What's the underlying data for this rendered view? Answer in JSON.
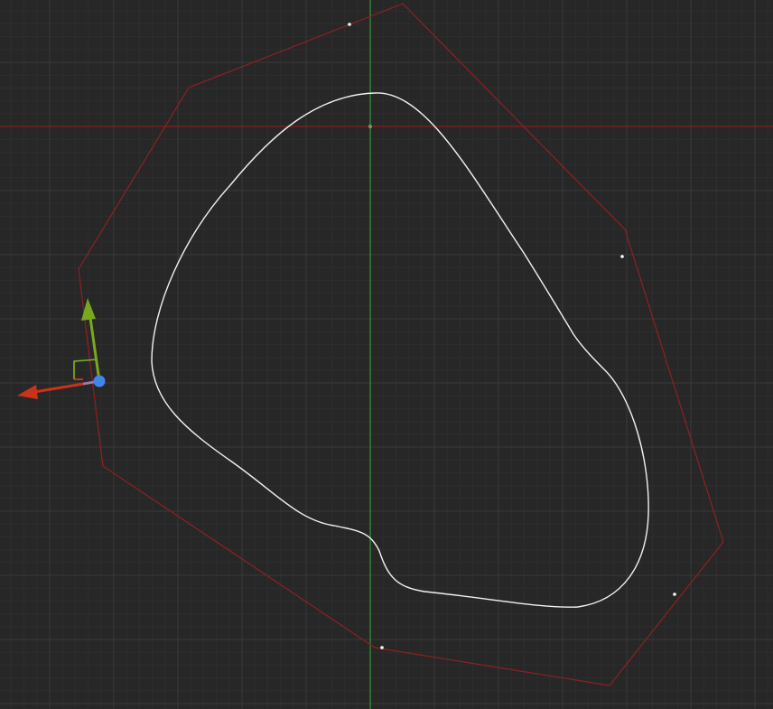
{
  "app": {
    "name": "3D viewport",
    "background_color": "#272727"
  },
  "grid": {
    "minor_color": "#2e2e2e",
    "major_color": "#3a3a3a"
  },
  "axes": {
    "x_axis_color": "#8b1a1a",
    "y_axis_color": "#2f9a2f"
  },
  "curve": {
    "color": "#f2f2f2",
    "control_polygon_color": "#8e2121",
    "control_point_count": 8
  },
  "gizmo": {
    "icon": "move-gizmo-icon",
    "x_color": "#c9331a",
    "y_color": "#79a81f",
    "z_color": "#3f86e8",
    "plane_x_color": "#d0421f",
    "plane_y_color": "#7fb320"
  }
}
